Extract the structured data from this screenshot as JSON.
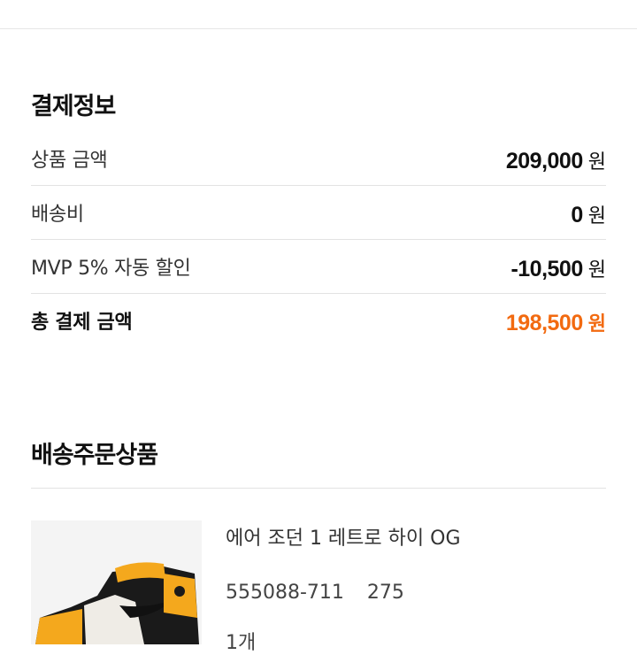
{
  "payment": {
    "title": "결제정보",
    "rows": [
      {
        "label": "상품 금액",
        "amount": "209,000",
        "unit": "원"
      },
      {
        "label": "배송비",
        "amount": "0",
        "unit": "원"
      },
      {
        "label": "MVP 5% 자동 할인",
        "amount": "-10,500",
        "unit": "원"
      }
    ],
    "total": {
      "label": "총 결제 금액",
      "amount": "198,500",
      "unit": "원"
    }
  },
  "shipping": {
    "title": "배송주문상품",
    "product": {
      "name": "에어 조던 1 레트로 하이 OG",
      "code": "555088-711",
      "size": "275",
      "quantity": "1개",
      "image_icon": "sneaker-image"
    }
  },
  "colors": {
    "accent": "#f26a10"
  }
}
